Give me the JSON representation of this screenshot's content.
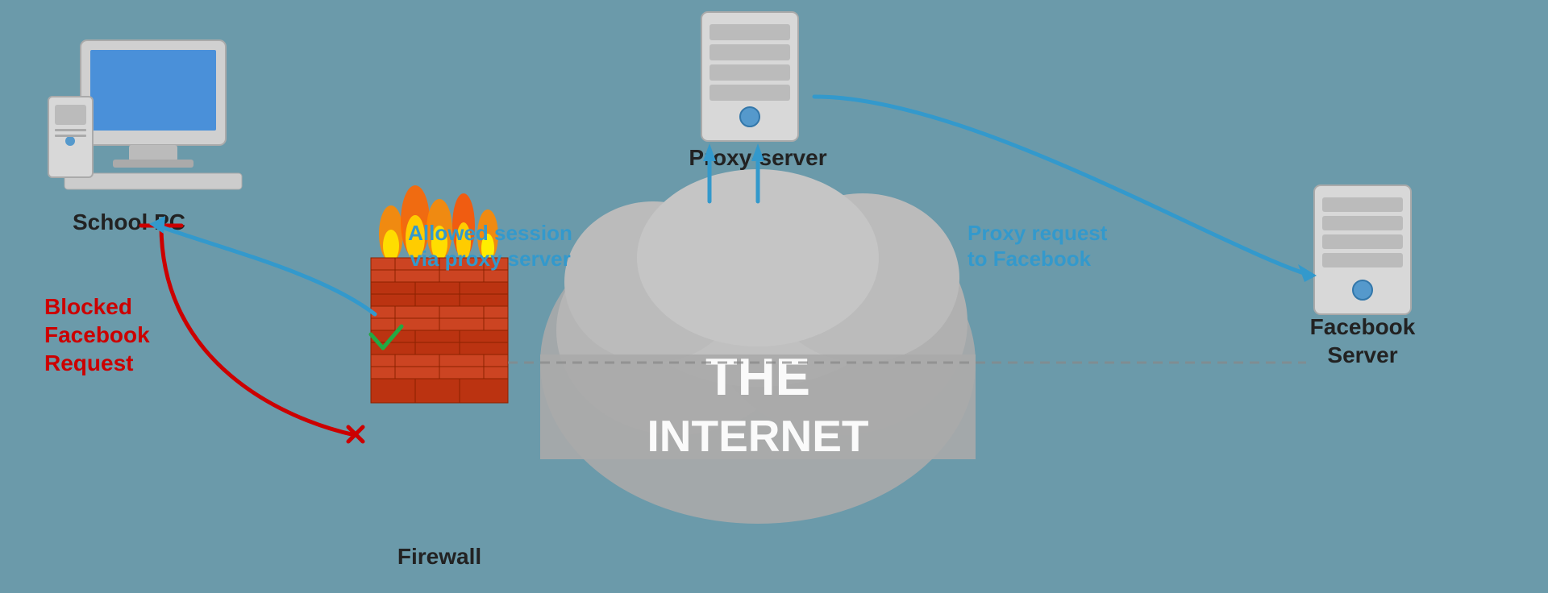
{
  "background_color": "#6b9aaa",
  "school_pc": {
    "label": "School PC"
  },
  "firewall": {
    "label": "Firewall"
  },
  "internet": {
    "label": "THE INTERNET"
  },
  "proxy_server": {
    "label": "Proxy-server"
  },
  "facebook_server": {
    "label": "Facebook Server"
  },
  "allowed_session_text": "Allowed session\nvia proxy server",
  "blocked_text": "Blocked\nFacebook\nRequest",
  "proxy_request_text": "Proxy request\nto Facebook",
  "arrows": {
    "blocked_red": "red curved arrow from PC downward with X mark",
    "allowed_blue": "blue curved arrow from firewall up to PC",
    "dashed_line": "dashed line from firewall through cloud to facebook server",
    "proxy_arrows": "blue arrows from cloud up to proxy server",
    "proxy_to_facebook": "blue arrow from proxy server down and right to facebook server"
  }
}
